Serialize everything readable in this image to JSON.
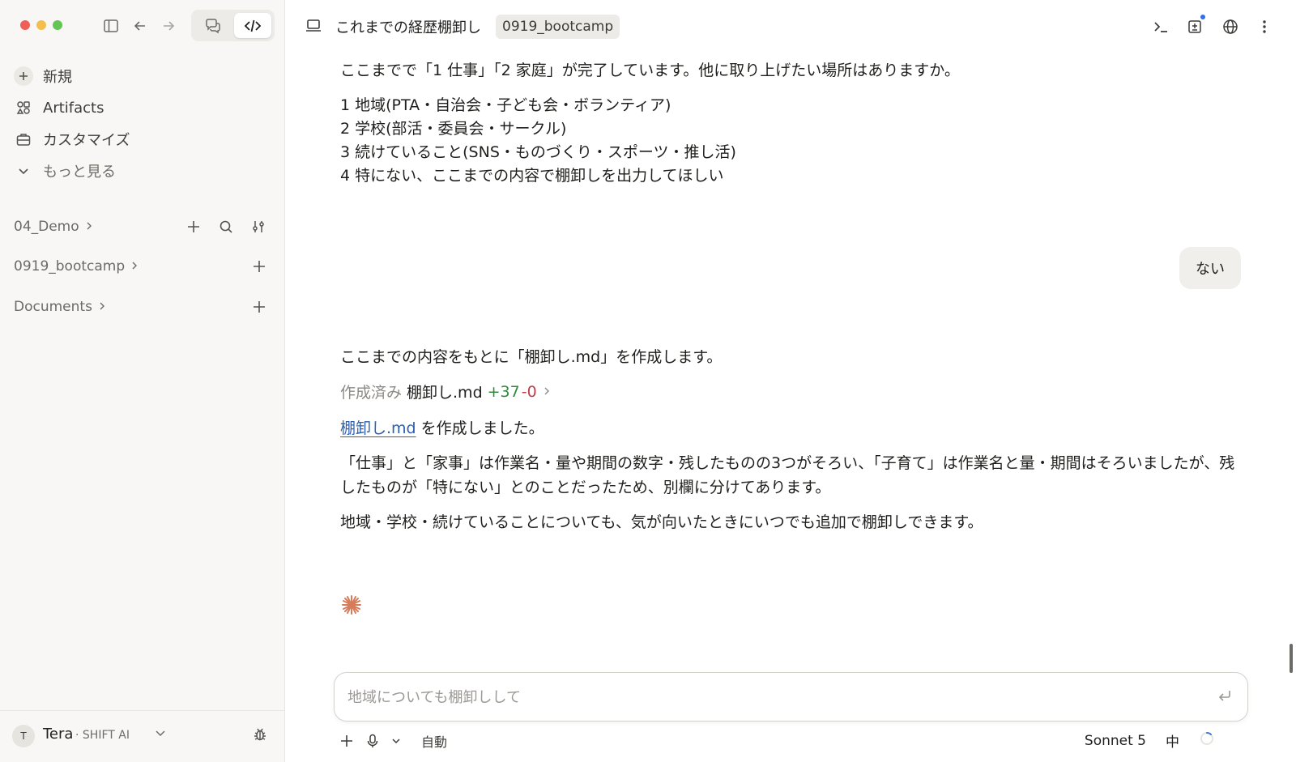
{
  "sidebar": {
    "nav": [
      {
        "label": "新規",
        "icon": "plus-icon"
      },
      {
        "label": "Artifacts",
        "icon": "artifacts-icon"
      },
      {
        "label": "カスタマイズ",
        "icon": "briefcase-icon"
      },
      {
        "label": "もっと見る",
        "icon": "chevron-down-icon"
      }
    ],
    "projects": [
      {
        "label": "04_Demo"
      },
      {
        "label": "0919_bootcamp"
      },
      {
        "label": "Documents"
      }
    ],
    "user": {
      "initial": "T",
      "name": "Tera",
      "org": "· SHIFT AI"
    }
  },
  "header": {
    "title": "これまでの経歴棚卸し",
    "badge": "0919_bootcamp"
  },
  "conversation": {
    "assistant_intro": "ここまでで「1 仕事」「2 家庭」が完了しています。他に取り上げたい場所はありますか。",
    "options": [
      "1 地域(PTA・自治会・子ども会・ボランティア)",
      "2 学校(部活・委員会・サークル)",
      "3 続けていること(SNS・ものづくり・スポーツ・推し活)",
      "4 特にない、ここまでの内容で棚卸しを出力してほしい"
    ],
    "user_reply": "ない",
    "assistant_create": "ここまでの内容をもとに「棚卸し.md」を作成します。",
    "created": {
      "prefix": "作成済み",
      "file": "棚卸し.md",
      "added": "+37",
      "removed": "-0"
    },
    "link_file": "棚卸し.md",
    "link_suffix": " を作成しました。",
    "para1": "「仕事」と「家事」は作業名・量や期間の数字・残したものの3つがそろい、「子育て」は作業名と量・期間はそろいましたが、残したものが「特にない」とのことだったため、別欄に分けてあります。",
    "para2": "地域・学校・続けていることについても、気が向いたときにいつでも追加で棚卸しできます。"
  },
  "composer": {
    "placeholder": "地域についても棚卸しして",
    "mode_label": "自動",
    "model": "Sonnet 5",
    "effort": "中"
  },
  "colors": {
    "accent_spark": "#d77c5a",
    "link": "#2b5fb0",
    "added": "#2e8b3e",
    "removed": "#c23b4b"
  }
}
